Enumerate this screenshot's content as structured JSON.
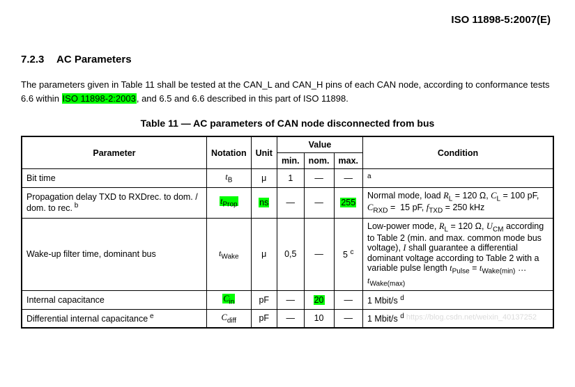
{
  "doc": {
    "id": "ISO 11898-5:2007(E)",
    "section_num": "7.2.3",
    "section_title": "AC Parameters",
    "body_pre": "The parameters given in Table 11 shall be tested at the CAN_L and CAN_H pins of each CAN node, according to conformance tests 6.6 within ",
    "body_hl": "ISO 11898-2:2003",
    "body_post": ", and 6.5 and 6.6 described in this part of ISO 11898.",
    "table_caption": "Table 11 — AC parameters of CAN node disconnected from bus"
  },
  "table": {
    "headers": {
      "param": "Parameter",
      "notation": "Notation",
      "unit": "Unit",
      "value": "Value",
      "min": "min.",
      "nom": "nom.",
      "max": "max.",
      "cond": "Condition"
    },
    "rows": [
      {
        "param_text": "Bit time",
        "param_sup": "",
        "notation_html": "<span class='ital'>t</span><sub>B</sub>",
        "notation_hl": false,
        "unit": "μ",
        "unit_hl": false,
        "min": "1",
        "nom": "—",
        "max": "—",
        "max_hl": false,
        "cond_html": "<span class='sup'>a</span>",
        "cond_center": true
      },
      {
        "param_text": "Propagation delay TXD to RXDrec. to dom. / dom. to rec.",
        "param_sup": " b",
        "notation_html": "<span class='ital'>t</span><sub>Prop</sub>",
        "notation_hl": true,
        "unit": "ns",
        "unit_hl": true,
        "min": "—",
        "nom": "—",
        "max": "255",
        "max_hl": true,
        "cond_html": "Normal mode, load <span class='ital'>R</span><sub>L</sub> = 120 Ω, <span class='ital'>C</span><sub>L</sub> = 100 pF, <span class='ital'>C</span><sub>RXD</sub> =&nbsp; 15 pF, <span class='ital'>f</span><sub>TXD</sub> = 250 kHz",
        "cond_center": false
      },
      {
        "param_text": "Wake-up filter time, dominant bus",
        "param_sup": "",
        "notation_html": "<span class='ital'>t</span><sub>Wake</sub>",
        "notation_hl": false,
        "unit": "μ",
        "unit_hl": false,
        "min": "0,5",
        "nom": "—",
        "max": "5 <span class='sup'>c</span>",
        "max_hl": false,
        "cond_html": "Low-power mode, <span class='ital'>R</span><sub>L</sub> = 120 Ω, <span class='ital'>U</span><sub>CM</sub> according to Table 2 (min. and max. common mode bus voltage), <span class='ital'>I</span> shall guarantee a differential dominant voltage according to Table 2 with a variable pulse length <span class='ital'>t</span><sub>Pulse</sub> = <span class='ital'>t</span><sub>Wake(min)</sub> … <span class='ital'>t</span><sub>Wake(max)</sub>",
        "cond_center": false
      },
      {
        "param_text": "Internal capacitance",
        "param_sup": "",
        "notation_html": "<span class='ital'>C</span><sub>in</sub>",
        "notation_hl": true,
        "unit": "pF",
        "unit_hl": false,
        "min": "—",
        "nom": "20",
        "nom_hl": true,
        "max": "—",
        "max_hl": false,
        "cond_html": "1 Mbit/s <span class='sup'>d</span>",
        "cond_center": false
      },
      {
        "param_text": "Differential internal capacitance",
        "param_sup": " e",
        "notation_html": "<span class='ital'>C</span><sub>diff</sub>",
        "notation_hl": false,
        "unit": "pF",
        "unit_hl": false,
        "min": "—",
        "nom": "10",
        "max": "—",
        "max_hl": false,
        "cond_html": "1 Mbit/s <span class='sup'>d</span>",
        "cond_center": false
      }
    ]
  },
  "watermark": "https://blog.csdn.net/weixin_40137252"
}
